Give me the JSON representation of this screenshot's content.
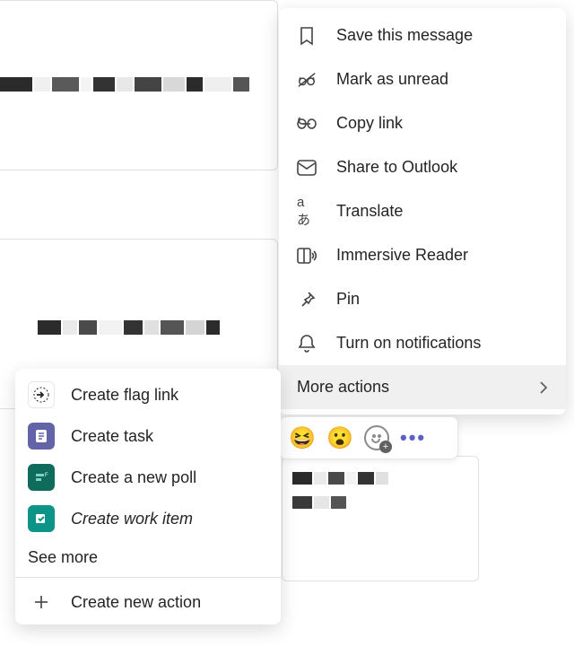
{
  "primary_menu": {
    "items": [
      {
        "label": "Save this message",
        "icon": "bookmark-icon"
      },
      {
        "label": "Mark as unread",
        "icon": "glasses-off-icon"
      },
      {
        "label": "Copy link",
        "icon": "link-icon"
      },
      {
        "label": "Share to Outlook",
        "icon": "mail-icon"
      },
      {
        "label": "Translate",
        "icon": "translate-icon"
      },
      {
        "label": "Immersive Reader",
        "icon": "reader-icon"
      },
      {
        "label": "Pin",
        "icon": "pin-icon"
      },
      {
        "label": "Turn on notifications",
        "icon": "bell-icon"
      }
    ],
    "more_actions_label": "More actions"
  },
  "secondary_menu": {
    "items": [
      {
        "label": "Create flag link",
        "icon_bg": "#ffffff",
        "icon": "arrow-circle"
      },
      {
        "label": "Create task",
        "icon_bg": "#6264a7",
        "icon": "task"
      },
      {
        "label": "Create a new poll",
        "icon_bg": "#0f6b5c",
        "icon": "poll"
      },
      {
        "label": "Create work item",
        "icon_bg": "#0d9488",
        "icon": "work-item",
        "italic": true
      }
    ],
    "see_more_label": "See more",
    "create_action_label": "Create new action"
  },
  "reactions": {
    "emojis": [
      "😆",
      "😮"
    ]
  }
}
